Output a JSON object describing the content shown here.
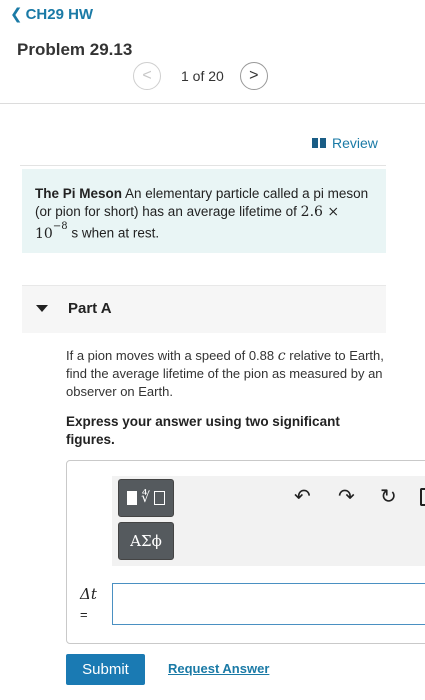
{
  "header": {
    "back_label": "CH29 HW",
    "problem_title": "Problem 29.13",
    "pager": {
      "prev": "<",
      "count": "1 of 20",
      "next": ">"
    }
  },
  "review_label": "Review",
  "statement": {
    "lead": "The Pi Meson",
    "text": "An elementary particle called a pi meson (or pion for short) has an average lifetime of",
    "value_base": "2.6 × 10",
    "value_exp": "−8",
    "value_tail": "s when at rest."
  },
  "part": {
    "title": "Part A",
    "question_before": "If a pion moves with a speed of 0.88",
    "question_symbol": "c",
    "question_after": "relative to Earth, find the average lifetime of the pion as measured by an observer on Earth.",
    "instruction": "Express your answer using two significant figures."
  },
  "editor": {
    "greek_label": "ΑΣϕ",
    "undo_icon": "↶",
    "redo_icon": "↷",
    "reset_icon": "↻",
    "var_label": "Δt",
    "eq_label": "=",
    "answer_value": ""
  },
  "footer": {
    "submit_label": "Submit",
    "request_label": "Request Answer"
  },
  "colors": {
    "link": "#1a7aa6",
    "submit": "#1a7ab3",
    "statement_bg": "#e9f5f5"
  }
}
